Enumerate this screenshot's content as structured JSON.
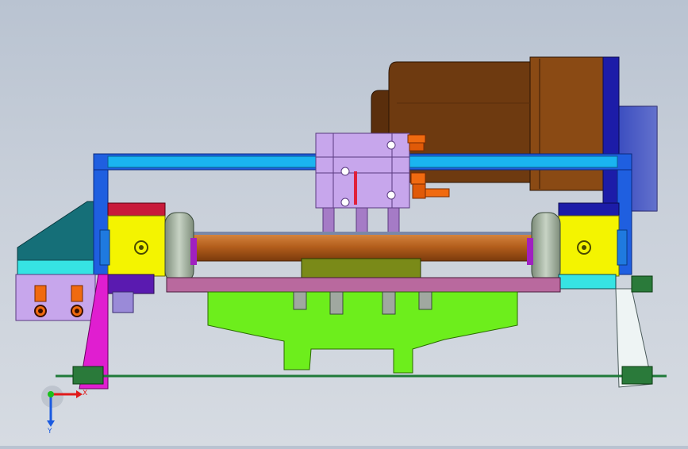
{
  "viewport": {
    "background_top": "#b9c3d1",
    "background_bottom": "#d6dbe2"
  },
  "colors": {
    "frame_blue": "#1f5fe0",
    "crossbar_cyan": "#1ab4f0",
    "motor_brown": "#6e3a10",
    "motor_end_cap": "#8a4a14",
    "gearbox_blue": "#1c1ca8",
    "bearing_yellow": "#f4f400",
    "roller_copper": "#b35e1c",
    "wheel_gray": "#a9b7a7",
    "base_green": "#6dee1c",
    "plate_mauve": "#b9699e",
    "cylinder_lavender": "#c7a6ec",
    "fitting_orange": "#f06a10",
    "leg_magenta": "#e01ed0",
    "leg_white": "#eef4f4",
    "ramp_teal": "#156f78",
    "accent_red": "#c81a3a",
    "rail_green": "#1f7a3a"
  },
  "triad": {
    "x_label": "X",
    "y_label": "Y",
    "x_color": "#e01a1a",
    "y_color": "#1a5ae0",
    "z_color": "#1ac01a"
  }
}
